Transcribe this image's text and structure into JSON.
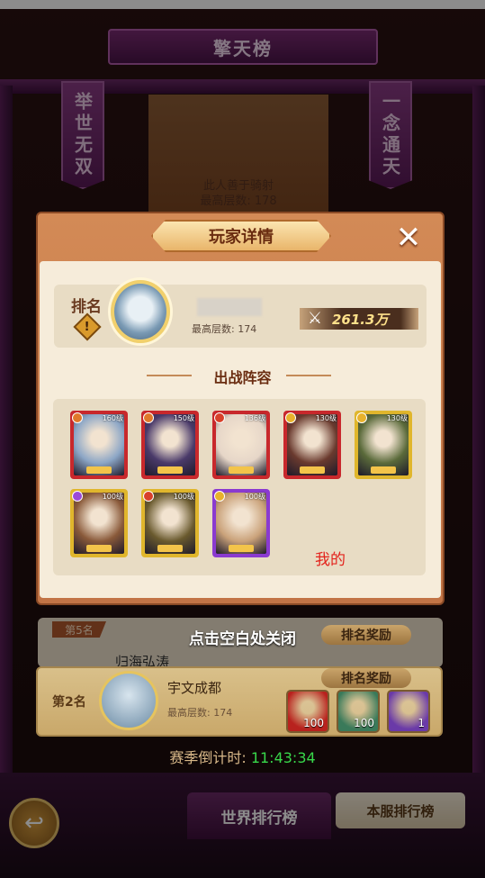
{
  "background": {
    "title": "擎天榜",
    "left_banner": "举世无双",
    "right_banner": "一念通天",
    "champion_motto": "此人善于骑射",
    "champion_floor": "最高层数: 178"
  },
  "modal": {
    "title": "玩家详情",
    "close_icon": "✕",
    "rank_label": "排名",
    "rank_badge": "!",
    "max_floor": "最高层数: 174",
    "power": "261.3万",
    "lineup_title": "出战阵容",
    "mine_label": "我的",
    "heroes": [
      {
        "level": "160级",
        "frame": "#c8282c",
        "art": "#8ca6c6",
        "elem": "#e0782a"
      },
      {
        "level": "150级",
        "frame": "#c8282c",
        "art": "#4a3a6a",
        "elem": "#e0782a"
      },
      {
        "level": "136级",
        "frame": "#c8282c",
        "art": "#e6d6c8",
        "elem": "#d8402a"
      },
      {
        "level": "130级",
        "frame": "#c8282c",
        "art": "#6a3a2e",
        "elem": "#e8b22c"
      },
      {
        "level": "130级",
        "frame": "#e0b62c",
        "art": "#5a6a3a",
        "elem": "#e8b22c"
      },
      {
        "level": "100级",
        "frame": "#e0b62c",
        "art": "#8a5a3a",
        "elem": "#9a4ad8"
      },
      {
        "level": "100级",
        "frame": "#e0b62c",
        "art": "#6a5a2e",
        "elem": "#d8402a"
      },
      {
        "level": "100级",
        "frame": "#8a3ad0",
        "art": "#caa27a",
        "elem": "#e8b22c"
      }
    ]
  },
  "close_hint": "点击空白处关闭",
  "rank5": {
    "badge": "第5名",
    "name": "归海弘涛",
    "reward_label": "排名奖励"
  },
  "rank2": {
    "label": "第2名",
    "name": "宇文成都",
    "floor": "最高层数: 174",
    "reward_label": "排名奖励",
    "items": [
      {
        "count": "100",
        "color": "#b8221e"
      },
      {
        "count": "100",
        "color": "#3a7a5a"
      },
      {
        "count": "1",
        "color": "#6a3aa8"
      }
    ]
  },
  "countdown": {
    "label": "赛季倒计时: ",
    "time": "11:43:34"
  },
  "tabs": {
    "world": "世界排行榜",
    "server": "本服排行榜"
  },
  "back_icon": "↩"
}
